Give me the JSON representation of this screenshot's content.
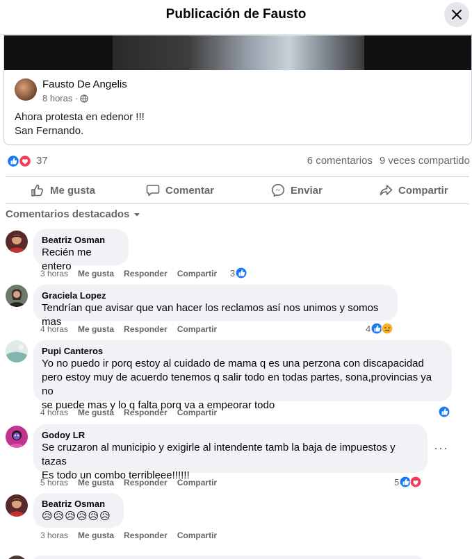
{
  "header": {
    "title": "Publicación de Fausto"
  },
  "post": {
    "author": "Fausto De Angelis",
    "time": "8 horas ·",
    "text_line1": "Ahora protesta en edenor !!!",
    "text_line2": "San Fernando."
  },
  "stats": {
    "reaction_count": "37",
    "comments": "6 comentarios",
    "shares": "9 veces compartido"
  },
  "actions": {
    "like": "Me gusta",
    "comment": "Comentar",
    "send": "Enviar",
    "share": "Compartir"
  },
  "sort_label": "Comentarios destacados",
  "comments": [
    {
      "name": "Beatriz Osman",
      "lines": [
        "Recién me entero"
      ],
      "time": "3 horas",
      "like": "Me gusta",
      "reply": "Responder",
      "share": "Compartir",
      "reactions": "3",
      "avatar_color": "#b03a3a"
    },
    {
      "name": "Graciela Lopez",
      "lines": [
        "Tendrían que avisar que van hacer los reclamos así nos unimos y somos mas"
      ],
      "time": "4 horas",
      "like": "Me gusta",
      "reply": "Responder",
      "share": "Compartir",
      "reactions": "4",
      "avatar_color": "#4a3b35"
    },
    {
      "name": "Pupi Canteros",
      "lines": [
        "Yo no puedo ir porq estoy al cuidado de mama q es una perzona con discapacidad",
        "pero estoy muy de acuerdo tenemos q salir todo en todas partes, sona,provincias ya no",
        "se puede mas y lo q falta porq va a empeorar todo"
      ],
      "time": "4 horas",
      "like": "Me gusta",
      "reply": "Responder",
      "share": "Compartir",
      "reactions": "",
      "avatar_color": "#7fb7b0"
    },
    {
      "name": "Godoy LR",
      "lines": [
        "Se cruzaron al municipio y exigirle al intendente tamb la baja de impuestos y tazas",
        "Es todo un combo terribleee!!!!!!"
      ],
      "time": "5 horas",
      "like": "Me gusta",
      "reply": "Responder",
      "share": "Compartir",
      "reactions": "5",
      "more": "···",
      "avatar_color": "#c0338f"
    },
    {
      "name": "Beatriz Osman",
      "lines": [
        "😥😥😥😥😥😥"
      ],
      "time": "3 horas",
      "like": "Me gusta",
      "reply": "Responder",
      "share": "Compartir",
      "reactions": "",
      "avatar_color": "#b03a3a"
    }
  ],
  "colors": {
    "like_blue": "#1877f2",
    "love_red": "#f33e58",
    "haha_yellow": "#f7b125",
    "bubble_bg": "#f0f2f5",
    "secondary_text": "#65676b"
  },
  "icons": [
    "close-icon",
    "globe-icon",
    "like-reaction-icon",
    "love-reaction-icon",
    "sad-reaction-icon",
    "thumbs-up-icon",
    "comment-icon",
    "messenger-icon",
    "share-icon",
    "caret-down-icon"
  ]
}
